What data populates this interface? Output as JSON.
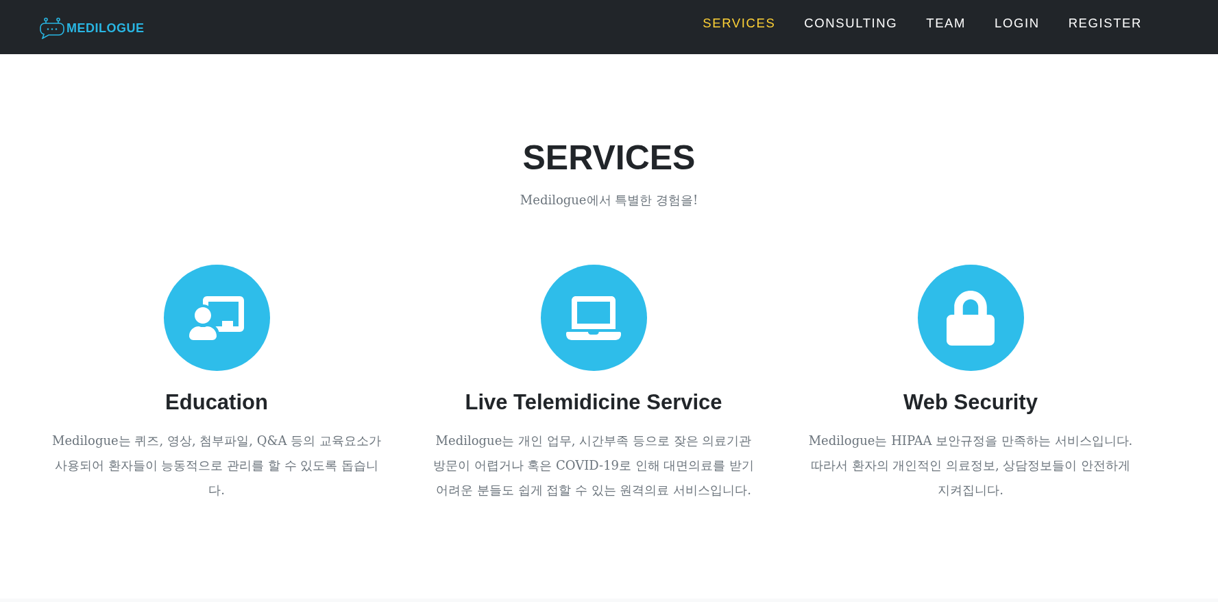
{
  "navbar": {
    "logo": {
      "text": "MEDILOGUE"
    },
    "links": [
      {
        "label": "SERVICES",
        "selected": true
      },
      {
        "label": "CONSULTING",
        "selected": false
      },
      {
        "label": "TEAM",
        "selected": false
      },
      {
        "label": "LOGIN",
        "selected": false
      },
      {
        "label": "REGISTER",
        "selected": false
      }
    ]
  },
  "section": {
    "title": "SERVICES",
    "subtitle": "Medilogue에서 특별한 경험을!",
    "services": [
      {
        "title": "Education",
        "description": "Medilogue는 퀴즈, 영상, 첨부파일, Q&A 등의 교육요소가 사용되어 환자들이 능동적으로 관리를 할 수 있도록 돕습니다."
      },
      {
        "title": "Live Telemidicine Service",
        "description": "Medilogue는 개인 업무, 시간부족 등으로 잦은 의료기관 방문이 어렵거나 혹은 COVID-19로 인해 대면의료를 받기 어려운 분들도 쉽게 접할 수 있는 원격의료 서비스입니다."
      },
      {
        "title": "Web Security",
        "description": "Medilogue는 HIPAA 보안규정을 만족하는 서비스입니다. 따라서 환자의 개인적인 의료정보, 상담정보들이 안전하게 지켜집니다."
      }
    ]
  }
}
